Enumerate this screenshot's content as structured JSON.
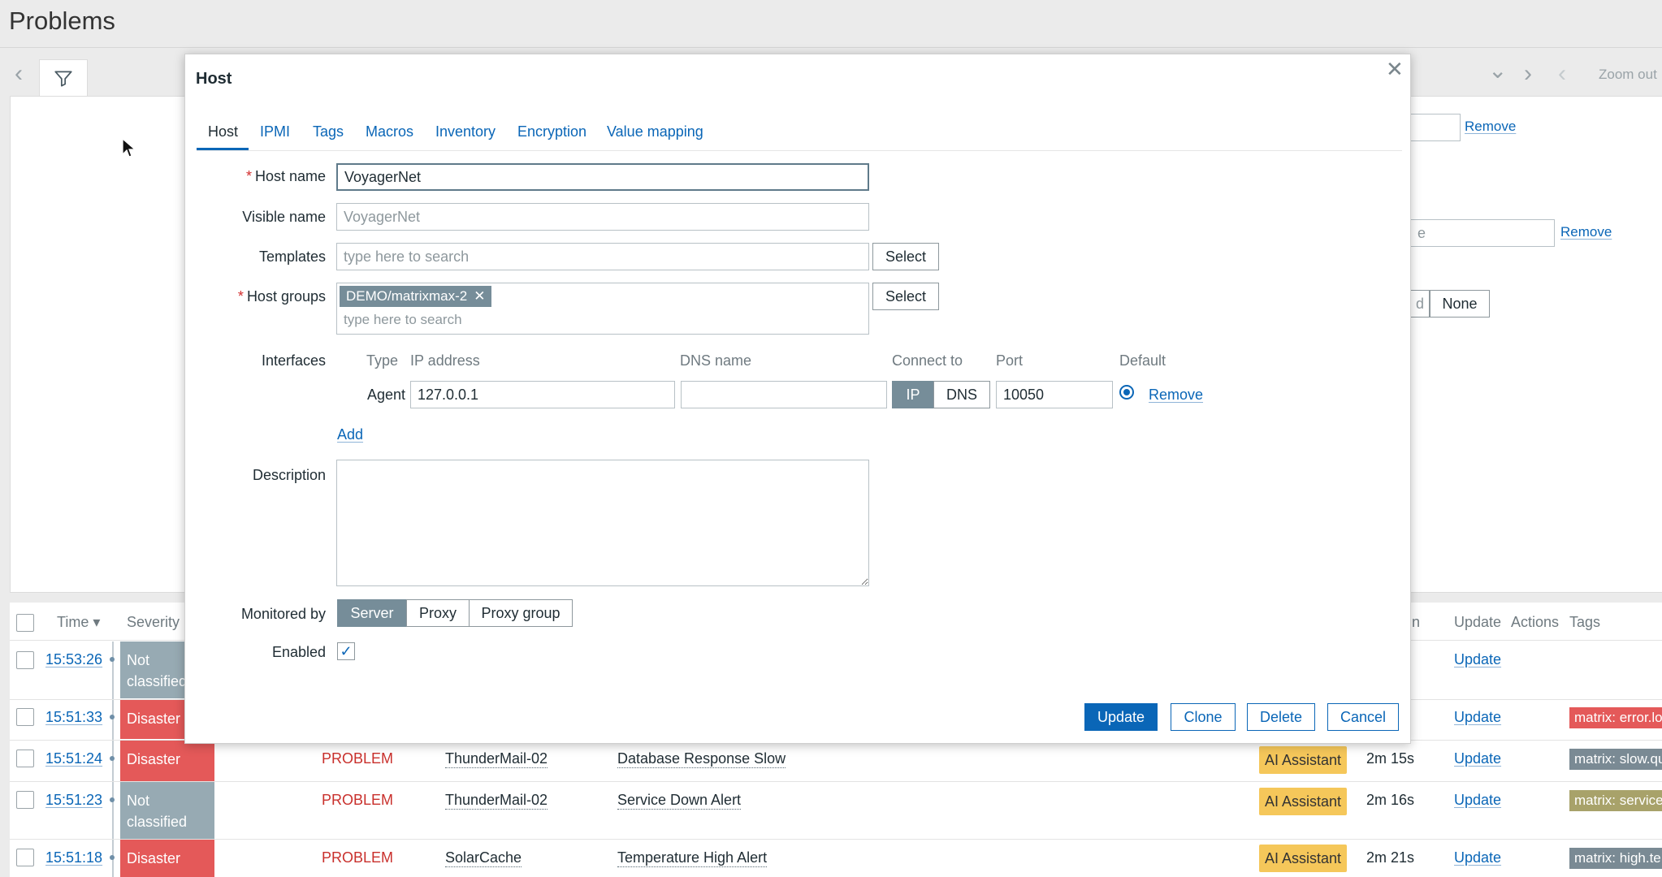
{
  "page": {
    "title": "Problems",
    "zoom_out": "Zoom out",
    "bg_remove_1": "Remove",
    "bg_remove_2": "Remove",
    "bg_input_fragment": "e",
    "bg_seg_fragment": "d",
    "bg_none": "None"
  },
  "table": {
    "headers": {
      "time": "Time ▾",
      "severity": "Severity",
      "duration_fragment": "n",
      "update": "Update",
      "actions": "Actions",
      "tags": "Tags"
    },
    "rows": [
      {
        "time": "15:53:26",
        "severity": "Not classified",
        "update": "Update"
      },
      {
        "time": "15:51:33",
        "severity": "Disaster",
        "update": "Update",
        "tag": "matrix: error.lo",
        "tag_color": "#e45959"
      },
      {
        "time": "15:51:24",
        "severity": "Disaster",
        "status": "PROBLEM",
        "host": "ThunderMail-02",
        "problem": "Database Response Slow",
        "action": "AI Assistant",
        "duration": "2m 15s",
        "update": "Update",
        "tag": "matrix: slow.qu",
        "tag_color": "#7a8a94"
      },
      {
        "time": "15:51:23",
        "severity": "Not classified",
        "status": "PROBLEM",
        "host": "ThunderMail-02",
        "problem": "Service Down Alert",
        "action": "AI Assistant",
        "duration": "2m 16s",
        "update": "Update",
        "tag": "matrix: service",
        "tag_color": "#a8a26a"
      },
      {
        "time": "15:51:18",
        "severity": "Disaster",
        "status": "PROBLEM",
        "host": "SolarCache",
        "problem": "Temperature High Alert",
        "action": "AI Assistant",
        "duration": "2m 21s",
        "update": "Update",
        "tag": "matrix: high.te",
        "tag_color": "#7a8a94"
      }
    ]
  },
  "modal": {
    "title": "Host",
    "tabs": [
      "Host",
      "IPMI",
      "Tags",
      "Macros",
      "Inventory",
      "Encryption",
      "Value mapping"
    ],
    "host_name": {
      "label": "Host name",
      "value": "VoyagerNet"
    },
    "visible_name": {
      "label": "Visible name",
      "placeholder": "VoyagerNet"
    },
    "templates": {
      "label": "Templates",
      "placeholder": "type here to search",
      "select": "Select"
    },
    "host_groups": {
      "label": "Host groups",
      "chip": "DEMO/matrixmax-2",
      "placeholder": "type here to search",
      "select": "Select"
    },
    "interfaces": {
      "label": "Interfaces",
      "headers": {
        "type": "Type",
        "ip": "IP address",
        "dns": "DNS name",
        "connect": "Connect to",
        "port": "Port",
        "default": "Default"
      },
      "agent": {
        "type": "Agent",
        "ip": "127.0.0.1",
        "dns": "",
        "connect_ip": "IP",
        "connect_dns": "DNS",
        "port": "10050",
        "remove": "Remove"
      },
      "add": "Add"
    },
    "description": {
      "label": "Description"
    },
    "monitored_by": {
      "label": "Monitored by",
      "options": [
        "Server",
        "Proxy",
        "Proxy group"
      ],
      "selected": "Server"
    },
    "enabled": {
      "label": "Enabled",
      "checked": true
    },
    "buttons": {
      "update": "Update",
      "clone": "Clone",
      "delete": "Delete",
      "cancel": "Cancel"
    }
  },
  "colors": {
    "accent": "#0a66b7",
    "disaster": "#e45959",
    "not_classified": "#97aab3",
    "problem": "#c9302c",
    "ai_badge": "#f5c75a"
  }
}
